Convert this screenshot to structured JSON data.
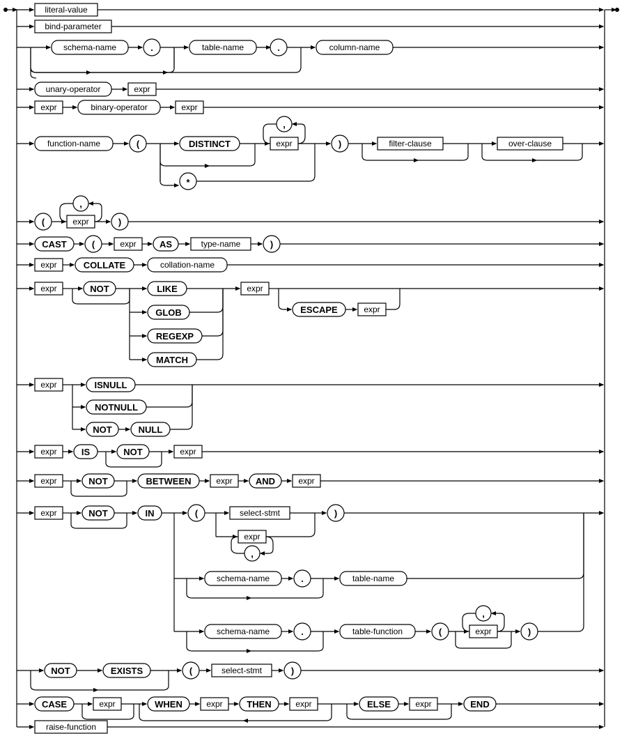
{
  "tokens": {
    "literal_value": "literal-value",
    "bind_parameter": "bind-parameter",
    "schema_name": "schema-name",
    "table_name": "table-name",
    "column_name": "column-name",
    "unary_operator": "unary-operator",
    "binary_operator": "binary-operator",
    "function_name": "function-name",
    "filter_clause": "filter-clause",
    "over_clause": "over-clause",
    "type_name": "type-name",
    "collation_name": "collation-name",
    "select_stmt": "select-stmt",
    "table_function": "table-function",
    "raise_function": "raise-function",
    "expr": "expr",
    "DISTINCT": "DISTINCT",
    "CAST": "CAST",
    "AS": "AS",
    "COLLATE": "COLLATE",
    "NOT": "NOT",
    "LIKE": "LIKE",
    "GLOB": "GLOB",
    "REGEXP": "REGEXP",
    "MATCH": "MATCH",
    "ESCAPE": "ESCAPE",
    "ISNULL": "ISNULL",
    "NOTNULL": "NOTNULL",
    "NULL": "NULL",
    "IS": "IS",
    "BETWEEN": "BETWEEN",
    "AND": "AND",
    "IN": "IN",
    "EXISTS": "EXISTS",
    "CASE": "CASE",
    "WHEN": "WHEN",
    "THEN": "THEN",
    "ELSE": "ELSE",
    "END": "END",
    "comma": ",",
    "dot": ".",
    "lparen": "(",
    "rparen": ")",
    "star": "*"
  }
}
